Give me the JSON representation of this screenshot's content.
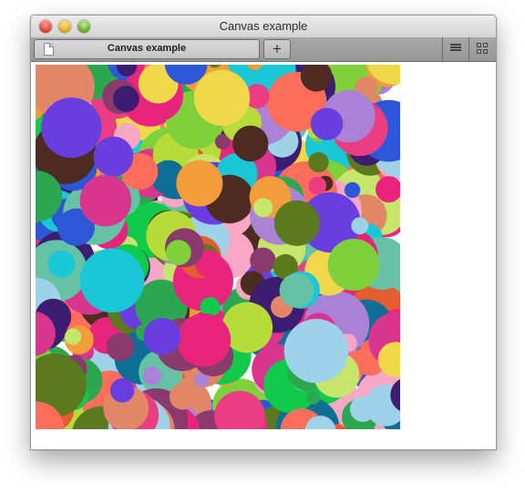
{
  "window": {
    "title": "Canvas example"
  },
  "tabbar": {
    "tab_label": "Canvas example",
    "new_tab_label": "+"
  },
  "icons": {
    "close": "close-button",
    "minimize": "minimize-button",
    "zoom": "zoom-button",
    "doc": "document-icon",
    "reader": "reader-icon",
    "grid": "top-sites-grid-icon"
  },
  "canvas": {
    "background": "#ffffff",
    "palette": [
      "#e8247d",
      "#2aa74f",
      "#6a3de0",
      "#f0d84a",
      "#19c7d6",
      "#b7db39",
      "#e45c2f",
      "#2c57d9",
      "#8a3a6d",
      "#11c94b",
      "#f7a7c3",
      "#c5e66b",
      "#4e2b20",
      "#ea3d82",
      "#5a7a1d",
      "#f39c3a",
      "#3d1d72",
      "#aa83d6",
      "#0f6e96",
      "#ff6e5c",
      "#9ed2e8",
      "#e28668",
      "#66c2a5",
      "#d9348e",
      "#7fd13b"
    ]
  }
}
